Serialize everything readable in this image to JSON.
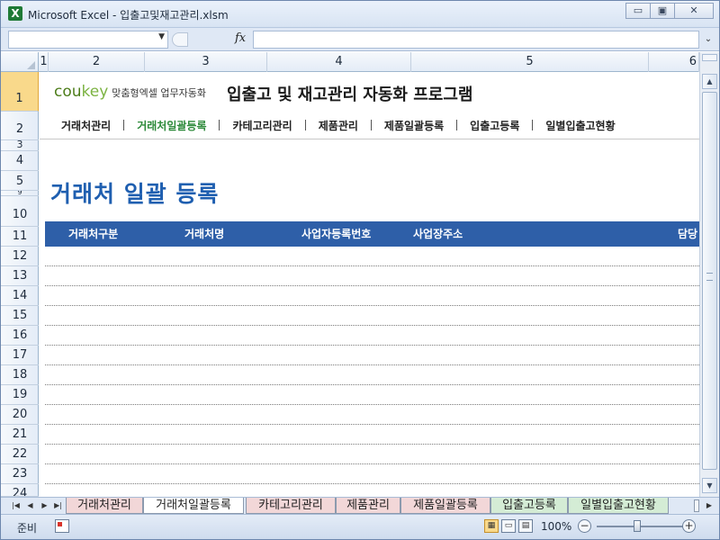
{
  "window": {
    "app_icon": "X",
    "title": "Microsoft Excel - 입출고및재고관리.xlsm",
    "minimize": "▭",
    "restore": "▣",
    "close": "✕"
  },
  "formula_bar": {
    "name_box_value": "",
    "fx_label": "fx",
    "formula_value": ""
  },
  "columns": [
    "1",
    "2",
    "3",
    "4",
    "5",
    "6"
  ],
  "rows": [
    "1",
    "2",
    "3",
    "4",
    "5",
    "9",
    "10",
    "11",
    "12",
    "13",
    "14",
    "15",
    "16",
    "17",
    "18",
    "19",
    "20",
    "21",
    "22",
    "23",
    "24"
  ],
  "brand": {
    "logo_main": "cou",
    "logo_accent": "key",
    "tagline": "맞춤형엑셀 업무자동화",
    "app_title": "입출고 및 재고관리 자동화 프로그램"
  },
  "menu": [
    {
      "label": "거래처관리",
      "active": false
    },
    {
      "label": "거래처일괄등록",
      "active": true
    },
    {
      "label": "카테고리관리",
      "active": false
    },
    {
      "label": "제품관리",
      "active": false
    },
    {
      "label": "제품일괄등록",
      "active": false
    },
    {
      "label": "입출고등록",
      "active": false
    },
    {
      "label": "일별입출고현황",
      "active": false
    }
  ],
  "page_heading": "거래처 일괄 등록",
  "table": {
    "headers": [
      "거래처구분",
      "거래처명",
      "사업자등록번호",
      "사업장주소",
      "담당"
    ]
  },
  "sheet_tabs": [
    {
      "label": "거래처관리",
      "state": "pink"
    },
    {
      "label": "거래처일괄등록",
      "state": "active"
    },
    {
      "label": "카테고리관리",
      "state": "pink"
    },
    {
      "label": "제품관리",
      "state": "pink"
    },
    {
      "label": "제품일괄등록",
      "state": "pink"
    },
    {
      "label": "입출고등록",
      "state": "green"
    },
    {
      "label": "일별입출고현황",
      "state": "green"
    }
  ],
  "status": {
    "ready_text": "준비",
    "zoom": "100%",
    "zoom_minus": "−",
    "zoom_plus": "+"
  },
  "colors": {
    "accent_green": "#2d8a3a",
    "heading_blue": "#1f5fb0",
    "table_header_blue": "#2e5fa8",
    "active_row_header": "#f9d98b"
  }
}
